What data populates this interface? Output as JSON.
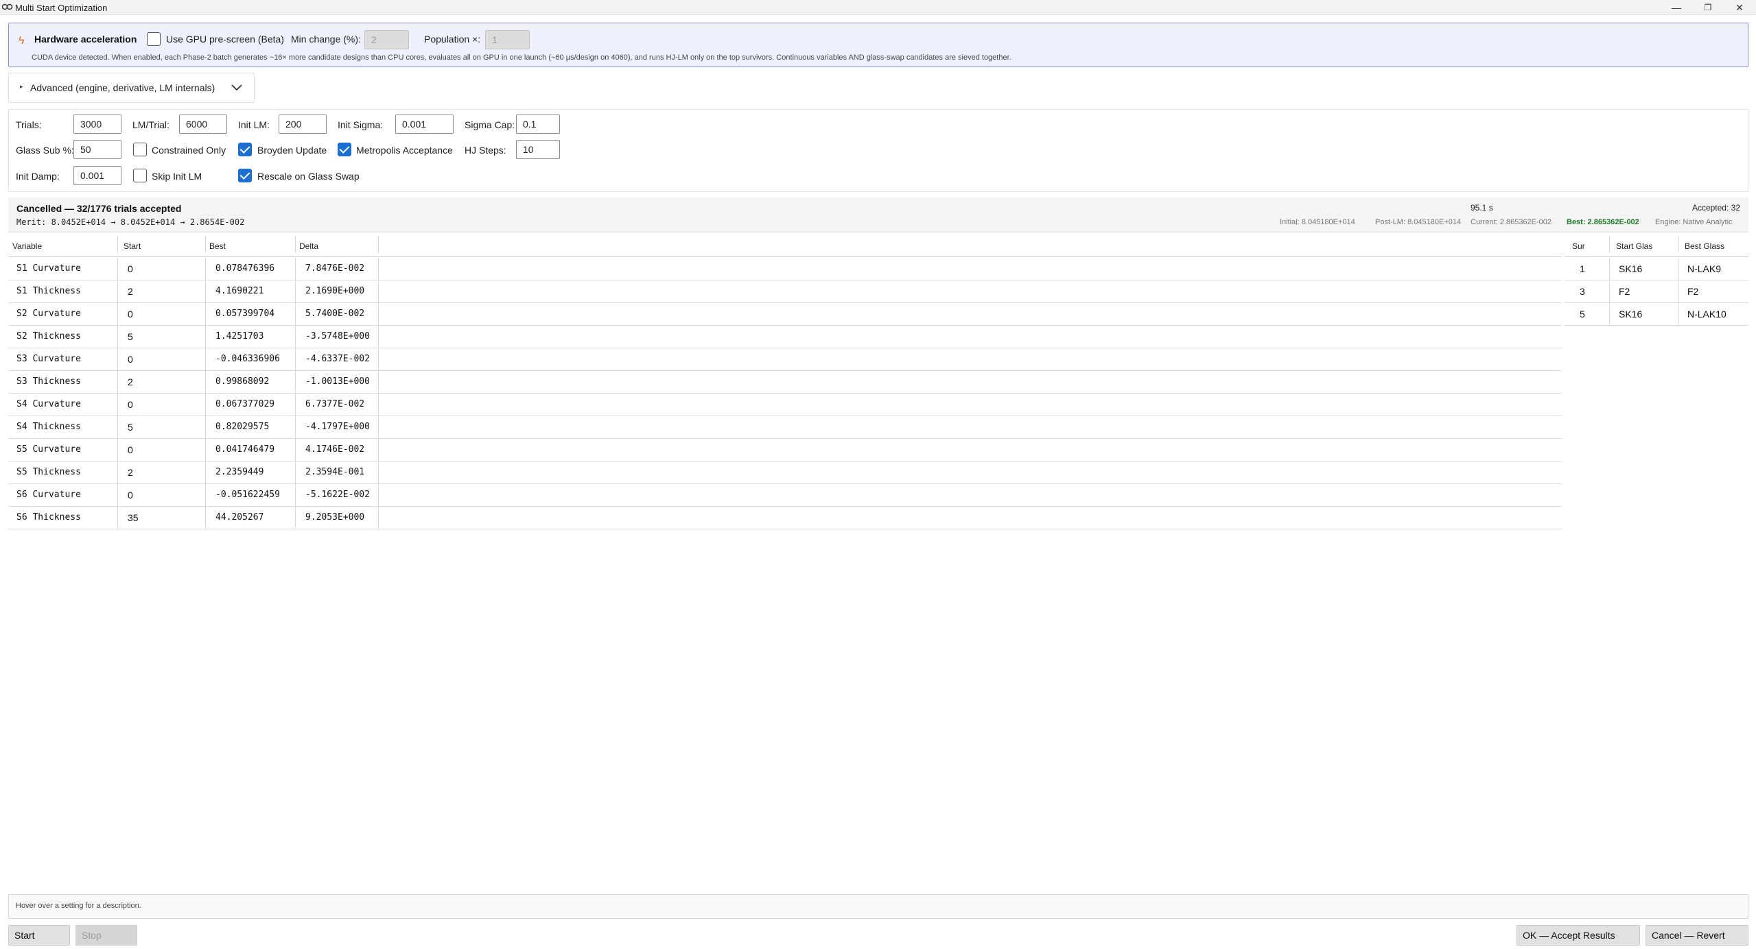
{
  "window": {
    "title": "Multi Start Optimization",
    "controls": [
      "—",
      "❐",
      "✕"
    ]
  },
  "hardware": {
    "title": "Hardware acceleration",
    "gpu_label": "Use GPU pre-screen (Beta)",
    "gpu_checked": false,
    "min_change_label": "Min change (%):",
    "min_change_value": "2",
    "population_label": "Population ×:",
    "population_value": "1",
    "note": "CUDA device detected. When enabled, each Phase-2 batch generates ~16× more candidate designs than CPU cores, evaluates all on GPU in one launch (~60 µs/design on 4060), and runs HJ-LM only on the top survivors. Continuous variables AND glass-swap candidates are sieved together."
  },
  "advanced": {
    "label": "Advanced (engine, derivative, LM internals)"
  },
  "settings": {
    "trials_label": "Trials:",
    "trials_value": "3000",
    "lm_trial_label": "LM/Trial:",
    "lm_trial_value": "6000",
    "init_lm_label": "Init LM:",
    "init_lm_value": "200",
    "init_sigma_label": "Init Sigma:",
    "init_sigma_value": "0.001",
    "sigma_cap_label": "Sigma Cap:",
    "sigma_cap_value": "0.1",
    "glass_sub_label": "Glass Sub %:",
    "glass_sub_value": "50",
    "constrained_only_label": "Constrained Only",
    "constrained_only_checked": false,
    "broyden_label": "Broyden Update",
    "broyden_checked": true,
    "metropolis_label": "Metropolis Acceptance",
    "metropolis_checked": true,
    "hj_steps_label": "HJ Steps:",
    "hj_steps_value": "10",
    "init_damp_label": "Init Damp:",
    "init_damp_value": "0.001",
    "skip_init_lm_label": "Skip Init LM",
    "skip_init_lm_checked": false,
    "rescale_label": "Rescale on Glass Swap",
    "rescale_checked": true
  },
  "status": {
    "headline": "Cancelled — 32/1776 trials accepted",
    "merit": "Merit: 8.0452E+014 → 8.0452E+014 → 2.8654E-002",
    "elapsed": "95.1 s",
    "accepted": "Accepted: 32",
    "initial": "Initial: 8.045180E+014",
    "post_lm": "Post-LM: 8.045180E+014",
    "current": "Current: 2.865362E-002",
    "best": "Best: 2.865362E-002",
    "engine": "Engine: Native Analytic"
  },
  "variables": {
    "headers": [
      "Variable",
      "Start",
      "Best",
      "Delta"
    ],
    "rows": [
      [
        "S1 Curvature",
        "0",
        "0.078476396",
        "7.8476E-002"
      ],
      [
        "S1 Thickness",
        "2",
        "4.1690221",
        "2.1690E+000"
      ],
      [
        "S2 Curvature",
        "0",
        "0.057399704",
        "5.7400E-002"
      ],
      [
        "S2 Thickness",
        "5",
        "1.4251703",
        "-3.5748E+000"
      ],
      [
        "S3 Curvature",
        "0",
        "-0.046336906",
        "-4.6337E-002"
      ],
      [
        "S3 Thickness",
        "2",
        "0.99868092",
        "-1.0013E+000"
      ],
      [
        "S4 Curvature",
        "0",
        "0.067377029",
        "6.7377E-002"
      ],
      [
        "S4 Thickness",
        "5",
        "0.82029575",
        "-4.1797E+000"
      ],
      [
        "S5 Curvature",
        "0",
        "0.041746479",
        "4.1746E-002"
      ],
      [
        "S5 Thickness",
        "2",
        "2.2359449",
        "2.3594E-001"
      ],
      [
        "S6 Curvature",
        "0",
        "-0.051622459",
        "-5.1622E-002"
      ],
      [
        "S6 Thickness",
        "35",
        "44.205267",
        "9.2053E+000"
      ]
    ]
  },
  "glasses": {
    "headers": [
      "Sur",
      "Start Glas",
      "Best Glass"
    ],
    "rows": [
      [
        "1",
        "SK16",
        "N-LAK9"
      ],
      [
        "3",
        "F2",
        "F2"
      ],
      [
        "5",
        "SK16",
        "N-LAK10"
      ]
    ]
  },
  "footer": {
    "hint": "Hover over a setting for a description.",
    "start_label": "Start",
    "stop_label": "Stop",
    "ok_label": "OK — Accept Results",
    "cancel_label": "Cancel — Revert"
  },
  "colors": {
    "accent": "#1b6fd0",
    "hw_border": "#8a8ee0",
    "best_green": "#1d7a25",
    "bolt": "#e06a1b"
  }
}
